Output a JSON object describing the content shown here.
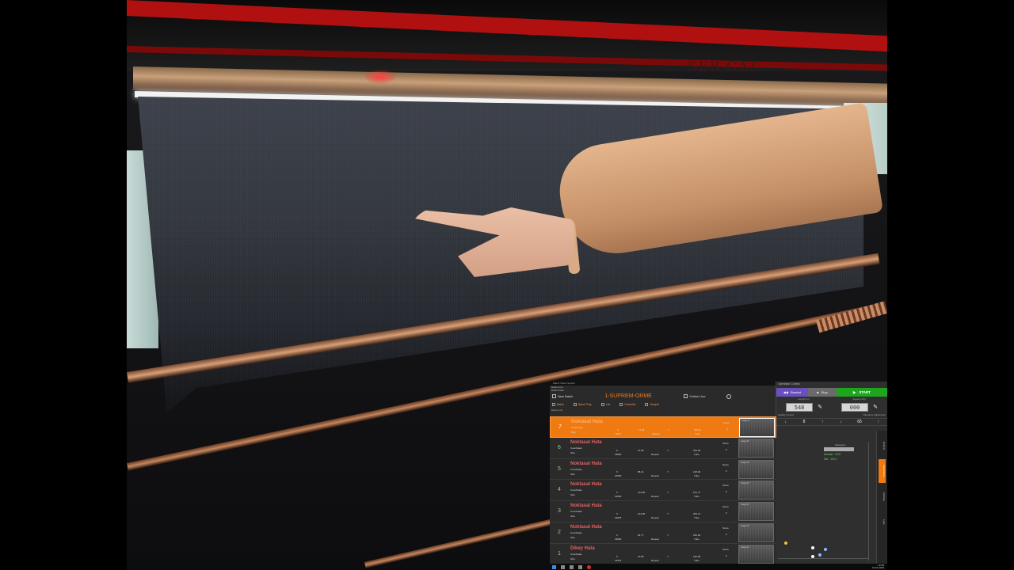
{
  "scene": {
    "machine_brand": "SER",
    "machine_brand_2": "CAT"
  },
  "app": {
    "window_title": "Fabric Vision System",
    "section_label": "Defect Info",
    "sub_label": "Defect Data",
    "new_batch_label": "New Batch",
    "batch_name": "1-SUPREM-ORME",
    "online_label": "Online Line",
    "tools": {
      "batch": "Batch",
      "batch_play": "Batch Play",
      "list": "List",
      "checklist": "Checklist",
      "sample": "Sample"
    },
    "list_header": "Defect List",
    "defects": [
      {
        "num": "7",
        "name": "Noktasal Hata",
        "coord_label": "Coordinate",
        "size_label": "Size",
        "x_label": "X",
        "x_val": "11,45",
        "y_label": "Y",
        "y_val": "205,74",
        "size_val": "5000",
        "repeat_label": "Repeat",
        "type_label": "Tube",
        "score_label": "Score",
        "score_val": "0",
        "thumb_label": "Image 07",
        "selected": true
      },
      {
        "num": "6",
        "name": "Noktasal Hata",
        "coord_label": "Coordinate",
        "size_label": "Size",
        "x_label": "X",
        "x_val": "97,89",
        "y_label": "Y",
        "y_val": "226,96",
        "size_val": "18800",
        "repeat_label": "Repeat",
        "type_label": "Tube",
        "score_label": "Score",
        "score_val": "0",
        "thumb_label": "Image 06",
        "selected": false
      },
      {
        "num": "5",
        "name": "Noktasal Hata",
        "coord_label": "Coordinate",
        "size_label": "Size",
        "x_label": "X",
        "x_val": "88,21",
        "y_label": "Y",
        "y_val": "218,92",
        "size_val": "22500",
        "repeat_label": "Repeat",
        "type_label": "Tube",
        "score_label": "Score",
        "score_val": "0",
        "thumb_label": "Image 05",
        "selected": false
      },
      {
        "num": "4",
        "name": "Noktasal Hata",
        "coord_label": "Coordinate",
        "size_label": "Size",
        "x_label": "X",
        "x_val": "104,99",
        "y_label": "Y",
        "y_val": "161,77",
        "size_val": "32000",
        "repeat_label": "Repeat",
        "type_label": "Tube",
        "score_label": "Score",
        "score_val": "0",
        "thumb_label": "Image 04",
        "selected": false
      },
      {
        "num": "3",
        "name": "Noktasal Hata",
        "coord_label": "Coordinate",
        "size_label": "Size",
        "x_label": "X",
        "x_val": "133,95",
        "y_label": "Y",
        "y_val": "205,72",
        "size_val": "16875",
        "repeat_label": "Repeat",
        "type_label": "Tube",
        "score_label": "Score",
        "score_val": "0",
        "thumb_label": "Image 03",
        "selected": false
      },
      {
        "num": "2",
        "name": "Noktasal Hata",
        "coord_label": "Coordinate",
        "size_label": "Size",
        "x_label": "X",
        "x_val": "84,77",
        "y_label": "Y",
        "y_val": "185,96",
        "size_val": "18800",
        "repeat_label": "Repeat",
        "type_label": "Tube",
        "score_label": "Score",
        "score_val": "0",
        "thumb_label": "Image 02",
        "selected": false
      },
      {
        "num": "1",
        "name": "Dikey Hata",
        "coord_label": "Coordinate",
        "size_label": "Size",
        "x_label": "X",
        "x_val": "19,85",
        "y_label": "Y",
        "y_val": "190,98",
        "size_val": "33412",
        "repeat_label": "Repeat",
        "type_label": "Tube",
        "score_label": "Score",
        "score_val": "0",
        "thumb_label": "Image 01",
        "selected": false
      }
    ],
    "clock": "12:38\n10.01.2020",
    "control": {
      "header": "Operation Control",
      "rewind": "Rewind",
      "stop": "Stop",
      "start": "START",
      "length_label": "Length (m)",
      "speed_label": "Speed (m/s)",
      "length_val": "548",
      "speed_val": "000",
      "quality_label": "Quality Control",
      "tolerance_label": "Tolerance Adjustment",
      "step1_val": "8",
      "step2_val": "65",
      "hist_title": "Histogram",
      "mean": "Median : 5,00",
      "std": "Std : 192,1",
      "side_tabs": [
        "Defects",
        "Parameters",
        "Settings",
        "Logs"
      ]
    },
    "colors": {
      "accent": "#ef7a12",
      "start": "#1ea51e",
      "rewind": "#6a4fbf",
      "defect_name": "#e46060"
    }
  }
}
